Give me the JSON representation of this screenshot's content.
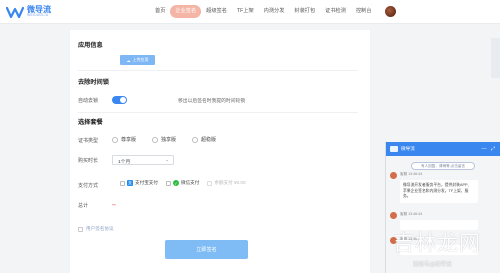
{
  "brand": {
    "name": "微导流",
    "sub": "WEIDAOLIU",
    "accent": "#3b87f0"
  },
  "nav": {
    "items": [
      {
        "label": "首页",
        "active": false
      },
      {
        "label": "企业签名",
        "active": true
      },
      {
        "label": "超级签名",
        "active": false
      },
      {
        "label": "TF上架",
        "active": false
      },
      {
        "label": "内测分发",
        "active": false
      },
      {
        "label": "封装打包",
        "active": false
      },
      {
        "label": "证书检测",
        "active": false
      },
      {
        "label": "控制台",
        "active": false
      }
    ]
  },
  "form": {
    "app_info_title": "应用信息",
    "upload_label": "上传应用",
    "remove_time_title": "去除时间锁",
    "auto_remove_label": "自动去锁",
    "auto_remove_desc": "移出以后签名时我提的时间轮锁",
    "package_title": "选择套餐",
    "cert_type_label": "证书类型",
    "cert_options": [
      "尊享版",
      "独享版",
      "超稳版"
    ],
    "duration_label": "购买时长",
    "duration_value": "1个月",
    "payment_label": "支付方式",
    "payment_options": [
      "支付宝支付",
      "微信支付",
      "余额支付 ¥0.00"
    ],
    "total_label": "总计",
    "total_value": "--",
    "agreement": "用户签名协议",
    "submit_label": "立即签名"
  },
  "chat": {
    "title": "微导流",
    "chip": "有人回复，请稍等,点击留言",
    "messages": [
      {
        "who": "客服 13:46:44",
        "text": "微导流开发者服务平台，提供封装APP、苹果企业签名和内测分发，TF上架，服务。"
      },
      {
        "who": "客服 13:46:44",
        "text": ""
      },
      {
        "who": "客服 13:46:44",
        "text": ""
      }
    ]
  },
  "watermark": {
    "big": "吉林龙网",
    "small": "搜狐号@微导流"
  }
}
